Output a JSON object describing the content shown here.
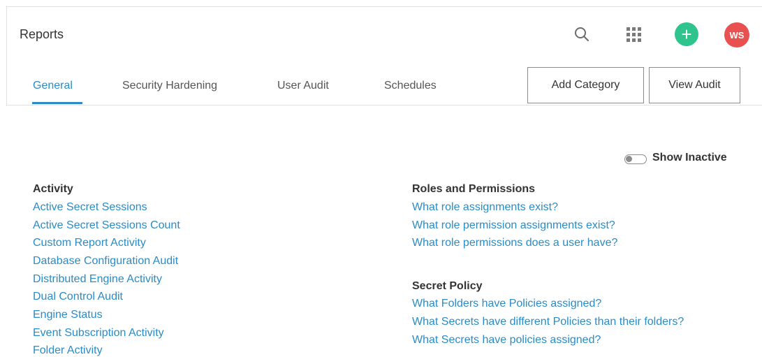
{
  "header": {
    "title": "Reports",
    "icons": [
      "search-icon",
      "apps-grid-icon",
      "add-icon"
    ],
    "avatar_initials": "WS",
    "colors": {
      "accent": "#2a8cc7",
      "add_button": "#2fc48d",
      "avatar": "#e8514f"
    }
  },
  "tabs": [
    {
      "label": "General",
      "active": true
    },
    {
      "label": "Security Hardening",
      "active": false
    },
    {
      "label": "User Audit",
      "active": false
    },
    {
      "label": "Schedules",
      "active": false
    }
  ],
  "actions": {
    "add_category": "Add Category",
    "view_audit": "View Audit"
  },
  "toggle": {
    "label": "Show Inactive",
    "on": false
  },
  "left_column": {
    "title": "Activity",
    "links": [
      "Active Secret Sessions",
      "Active Secret Sessions Count",
      "Custom Report Activity",
      "Database Configuration Audit",
      "Distributed Engine Activity",
      "Dual Control Audit",
      "Engine Status",
      "Event Subscription Activity",
      "Folder Activity"
    ]
  },
  "right_column": {
    "roles": {
      "title": "Roles and Permissions",
      "links": [
        "What role assignments exist?",
        "What role permission assignments exist?",
        "What role permissions does a user have?"
      ]
    },
    "policy": {
      "title": "Secret Policy",
      "links": [
        "What Folders have Policies assigned?",
        "What Secrets have different Policies than their folders?",
        "What Secrets have policies assigned?"
      ]
    }
  }
}
